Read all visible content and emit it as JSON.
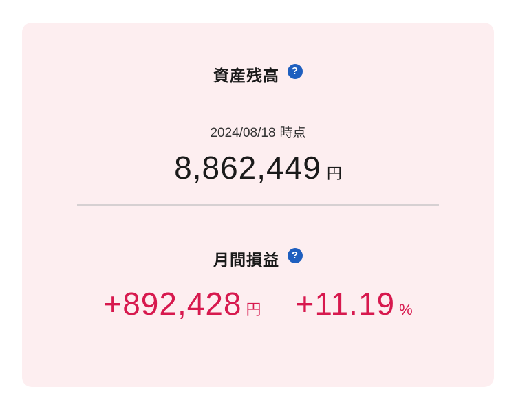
{
  "asset_balance": {
    "title": "資産残高",
    "date": "2024/08/18",
    "date_suffix": "時点",
    "amount": "8,862,449",
    "unit": "円"
  },
  "monthly_pl": {
    "title": "月間損益",
    "amount": "+892,428",
    "amount_unit": "円",
    "percent": "+11.19",
    "percent_unit": "%"
  },
  "help_icon_glyph": "?",
  "colors": {
    "card_background": "#fdeef0",
    "help_icon": "#1f5fbf",
    "positive": "#d7194e",
    "text": "#1a1a1a"
  },
  "icons": {
    "help": "question-circle-icon"
  }
}
